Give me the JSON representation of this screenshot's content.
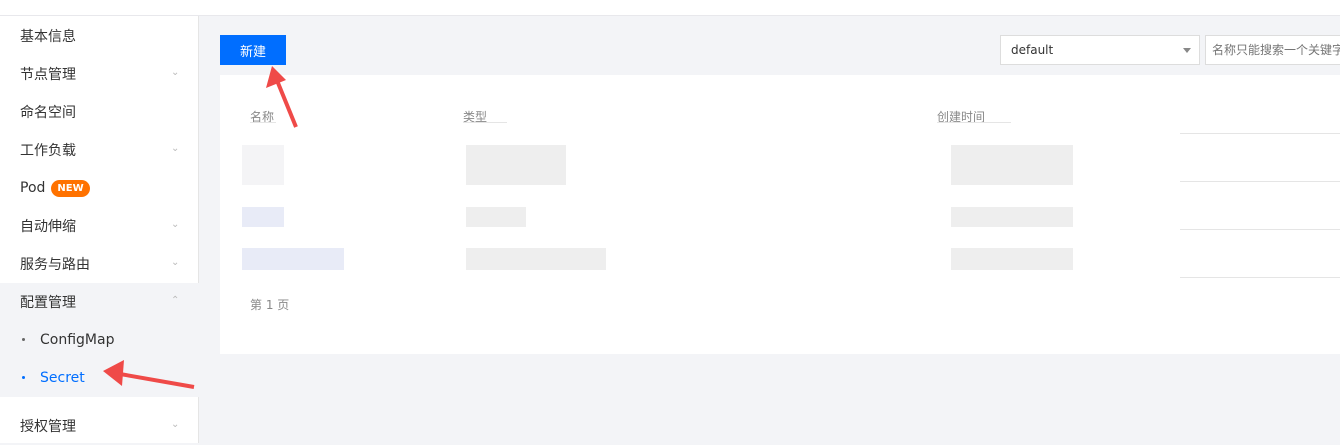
{
  "sidebar": {
    "items": [
      {
        "label": "基本信息"
      },
      {
        "label": "节点管理"
      },
      {
        "label": "命名空间"
      },
      {
        "label": "工作负载"
      },
      {
        "label": "Pod",
        "badge": "NEW"
      },
      {
        "label": "自动伸缩"
      },
      {
        "label": "服务与路由"
      },
      {
        "label": "配置管理"
      },
      {
        "label": "授权管理"
      }
    ],
    "config_sub": [
      {
        "label": "ConfigMap"
      },
      {
        "label": "Secret"
      }
    ],
    "chevron_down": "⌄",
    "chevron_up": "⌃"
  },
  "toolbar": {
    "new_label": "新建",
    "namespace_value": "default",
    "search_placeholder": "名称只能搜索一个关键字"
  },
  "table": {
    "columns": [
      "名称",
      "类型",
      "创建时间"
    ],
    "pager": "第 1 页"
  },
  "colors": {
    "primary": "#006eff",
    "badge": "#ff7200",
    "annotation_arrow": "#ef4a48"
  }
}
